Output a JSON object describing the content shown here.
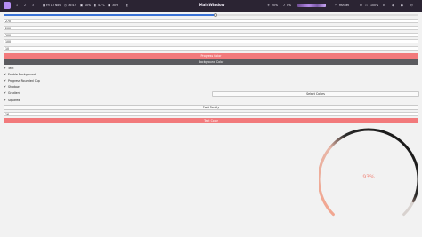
{
  "topbar": {
    "workspaces": [
      "1",
      "2",
      "3"
    ],
    "date": "Fri 10 Nov",
    "time": "16:47",
    "cpu": "10%",
    "temp": "47°C",
    "ram": "30%",
    "window_title": "MainWindow",
    "brightness": "20%",
    "volume": "0%",
    "network": "fishnet",
    "battery": "100%",
    "colors": {
      "bar_bg": "#2b2433",
      "accent": "#b58df2"
    }
  },
  "progress_slider": {
    "value": 0.51
  },
  "fields": [
    "270",
    "200",
    "200",
    "100",
    "10"
  ],
  "buttons": {
    "progress_color": "Progress Color",
    "background_color": "Background Color",
    "select_colors": "Select Colors",
    "font_family": "Font Family",
    "text_color": "Text Color"
  },
  "options": [
    {
      "label": "Text",
      "checked": true
    },
    {
      "label": "Enable Background",
      "checked": true
    },
    {
      "label": "Progress Rounded Cap",
      "checked": true
    },
    {
      "label": "Shadow",
      "checked": true
    },
    {
      "label": "Gradient",
      "checked": true
    },
    {
      "label": "Squared",
      "checked": true
    }
  ],
  "font_size_field": "16",
  "gauge": {
    "value_text": "93%",
    "progress": 0.93,
    "colors": {
      "track": "#d8d2cf",
      "progress_start": "#f4a38c",
      "progress_end": "#111111",
      "text": "#f08a7e"
    }
  }
}
